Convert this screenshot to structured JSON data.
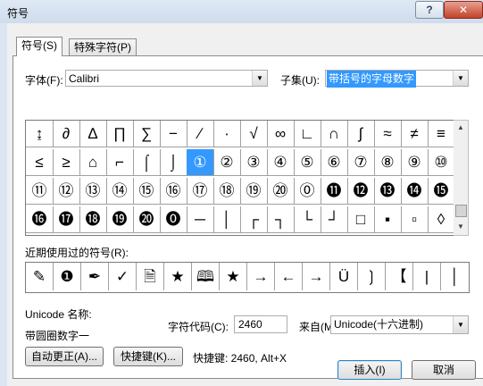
{
  "window": {
    "title": "符号",
    "help_label": "?",
    "close_label": "✕"
  },
  "tabs": [
    {
      "label": "符号(S)",
      "active": true
    },
    {
      "label": "特殊字符(P)",
      "active": false
    }
  ],
  "font": {
    "label": "字体(F):",
    "value": "Calibri"
  },
  "subset": {
    "label": "子集(U):",
    "value": "带括号的字母数字"
  },
  "symbols": [
    [
      "↨",
      "∂",
      "∆",
      "∏",
      "∑",
      "−",
      "∕",
      "∙",
      "√",
      "∞",
      "∟",
      "∩",
      "∫",
      "≈",
      "≠",
      "≡"
    ],
    [
      "≤",
      "≥",
      "⌂",
      "⌐",
      "⌠",
      "⌡",
      "①",
      "②",
      "③",
      "④",
      "⑤",
      "⑥",
      "⑦",
      "⑧",
      "⑨",
      "⑩"
    ],
    [
      "⑪",
      "⑫",
      "⑬",
      "⑭",
      "⑮",
      "⑯",
      "⑰",
      "⑱",
      "⑲",
      "⑳",
      "⓪",
      "⓫",
      "⓬",
      "⓭",
      "⓮",
      "⓯"
    ],
    [
      "⓰",
      "⓱",
      "⓲",
      "⓳",
      "⓴",
      "⓿",
      "─",
      "│",
      "┌",
      "┐",
      "└",
      "┘",
      "□",
      "▪",
      "▫",
      "◊"
    ]
  ],
  "selected_symbol": "①",
  "recent": {
    "label": "近期使用过的符号(R):",
    "items": [
      "✎",
      "❶",
      "✒",
      "✓",
      "🗎",
      "★",
      "🕮",
      "★",
      "→",
      "←",
      "→",
      "Ü",
      "❳",
      "【",
      "|",
      "│"
    ]
  },
  "unicode_name": {
    "label": "Unicode 名称:",
    "value": "带圆圈数字一"
  },
  "char_code": {
    "label": "字符代码(C):",
    "value": "2460"
  },
  "from": {
    "label": "来自(M):",
    "value": "Unicode(十六进制)"
  },
  "buttons": {
    "autocorrect": "自动更正(A)...",
    "shortcut_key": "快捷键(K)...",
    "shortcut_text": "快捷键: 2460, Alt+X",
    "insert": "插入(I)",
    "cancel": "取消"
  }
}
